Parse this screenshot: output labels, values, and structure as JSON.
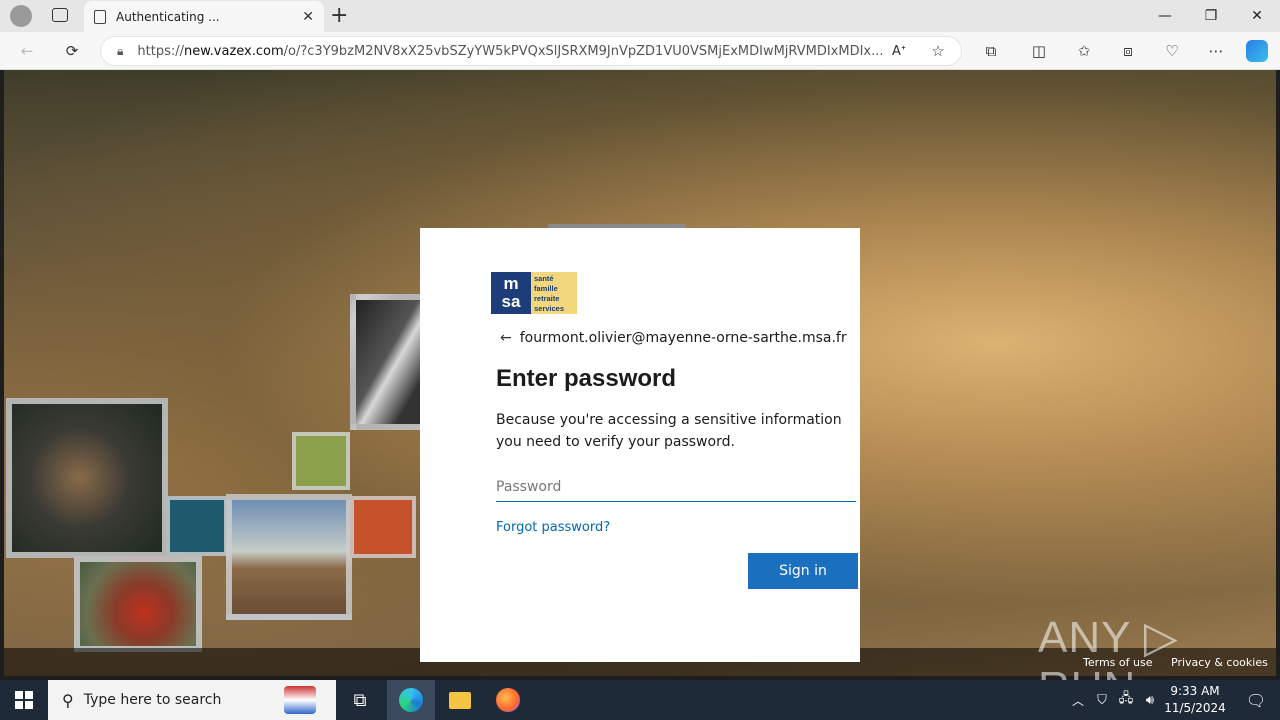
{
  "browser": {
    "tab_title": "Authenticating ...",
    "tab_close": "✕",
    "new_tab": "+",
    "url_prefix": "https://",
    "url_host": "new.vazex.com",
    "url_rest": "/o/?c3Y9bzM2NV8xX25vbSZyYW5kPVQxSlJSRXM9JnVpZD1VU0VSMjExMDIwMjRVMDIxMDIx...",
    "minimize": "—",
    "maximize": "❐",
    "close": "✕"
  },
  "dialog": {
    "logo_letters": [
      "m",
      "sa"
    ],
    "logo_tags": [
      "santé",
      "famille",
      "retraite",
      "services"
    ],
    "back_arrow": "←",
    "email": "fourmont.olivier@mayenne-orne-sarthe.msa.fr",
    "title": "Enter password",
    "description": "Because you're accessing a sensitive information you need to verify your password.",
    "password_placeholder": "Password",
    "forgot_link": "Forgot password?",
    "signin_label": "Sign in"
  },
  "footer": {
    "terms": "Terms of use",
    "privacy": "Privacy & cookies"
  },
  "watermark": "ANY ▷ RUN",
  "taskbar": {
    "search_placeholder": "Type here to search",
    "time": "9:33 AM",
    "date": "11/5/2024"
  },
  "colors": {
    "accent": "#0067b8",
    "signin_bg": "#1a6fbe",
    "logo_blue": "#1c3d7a",
    "logo_yellow": "#f3d77c"
  }
}
